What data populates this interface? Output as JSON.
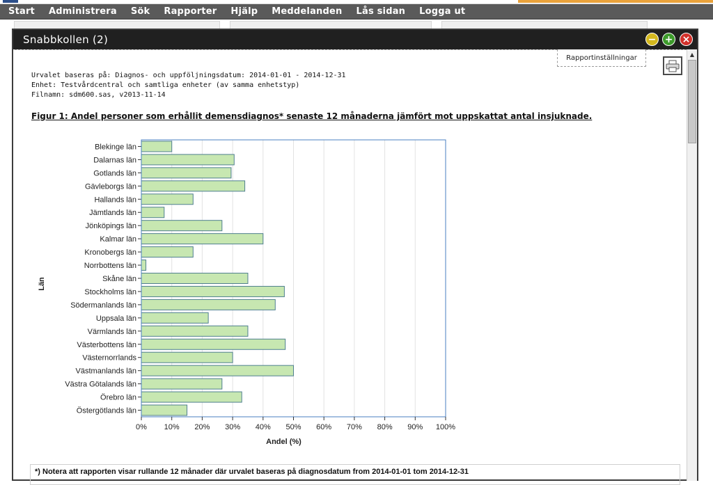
{
  "menu": {
    "items": [
      "Start",
      "Administrera",
      "Sök",
      "Rapporter",
      "Hjälp",
      "Meddelanden",
      "Lås sidan",
      "Logga ut"
    ]
  },
  "panel": {
    "title": "Snabbkollen (2)",
    "settings_label": "Rapportinställningar"
  },
  "report": {
    "meta": [
      "Urvalet baseras på: Diagnos- och uppföljningsdatum: 2014-01-01 - 2014-12-31",
      "Enhet: Testvårdcentral och samtliga enheter (av samma enhetstyp)",
      "Filnamn: sdm600.sas, v2013-11-14"
    ],
    "figure_title": "Figur 1: Andel personer som erhållit demensdiagnos* senaste 12 månaderna jämfört mot uppskattat antal insjuknade.",
    "footnote": "*) Notera att rapporten visar rullande 12 månader där urvalet baseras på diagnosdatum from 2014-01-01 tom 2014-12-31"
  },
  "colors": {
    "menu_bg": "#5a5a5a",
    "header_bg": "#202020",
    "bar_fill": "#c7e7b1",
    "bar_stroke": "#4f7f8f",
    "plot_border": "#4a7fc0"
  },
  "chart_data": {
    "type": "bar",
    "orientation": "horizontal",
    "categories": [
      "Blekinge län",
      "Dalarnas län",
      "Gotlands län",
      "Gävleborgs län",
      "Hallands län",
      "Jämtlands län",
      "Jönköpings län",
      "Kalmar län",
      "Kronobergs län",
      "Norrbottens län",
      "Skåne län",
      "Stockholms län",
      "Södermanlands län",
      "Uppsala län",
      "Värmlands län",
      "Västerbottens län",
      "Västernorrlands",
      "Västmanlands län",
      "Västra Götalands län",
      "Örebro län",
      "Östergötlands län"
    ],
    "values": [
      10,
      30.5,
      29.5,
      34,
      17,
      7.5,
      26.5,
      40,
      17,
      1.5,
      35,
      47,
      44,
      22,
      35,
      47.3,
      30,
      50,
      26.5,
      33,
      15
    ],
    "xlabel": "Andel (%)",
    "ylabel": "Län",
    "xlim": [
      0,
      100
    ],
    "xticks": [
      "0%",
      "10%",
      "20%",
      "30%",
      "40%",
      "50%",
      "60%",
      "70%",
      "80%",
      "90%",
      "100%"
    ],
    "grid": true
  }
}
